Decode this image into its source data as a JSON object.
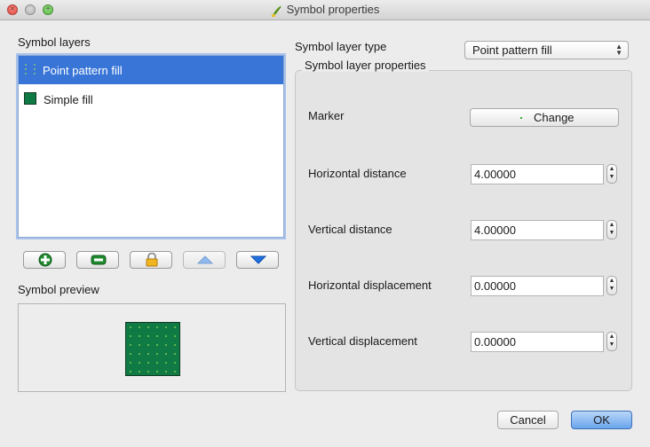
{
  "window": {
    "title": "Symbol properties"
  },
  "left": {
    "layers_heading": "Symbol layers",
    "layers": [
      {
        "label": "Point pattern fill",
        "selected": true,
        "icon": "point-pattern-swatch-icon"
      },
      {
        "label": "Simple fill",
        "selected": false,
        "icon": "simple-fill-swatch-icon",
        "color": "#0f7a43"
      }
    ],
    "toolbar": [
      {
        "name": "add-layer-button",
        "icon": "plus-icon"
      },
      {
        "name": "remove-layer-button",
        "icon": "minus-icon"
      },
      {
        "name": "lock-layer-button",
        "icon": "lock-icon"
      },
      {
        "name": "move-up-button",
        "icon": "arrow-up-icon"
      },
      {
        "name": "move-down-button",
        "icon": "arrow-down-icon"
      }
    ],
    "preview_heading": "Symbol preview"
  },
  "right": {
    "type_label": "Symbol layer type",
    "type_value": "Point pattern fill",
    "group_title": "Symbol layer properties",
    "marker_label": "Marker",
    "change_label": "Change",
    "fields": [
      {
        "label": "Horizontal distance",
        "value": "4.00000"
      },
      {
        "label": "Vertical distance",
        "value": "4.00000"
      },
      {
        "label": "Horizontal displacement",
        "value": "0.00000"
      },
      {
        "label": "Vertical displacement",
        "value": "0.00000"
      }
    ]
  },
  "footer": {
    "cancel_label": "Cancel",
    "ok_label": "OK"
  },
  "colors": {
    "selection": "#3875d7",
    "fill_green": "#0f7a43",
    "pattern_dot": "#9be05a",
    "ok_blue": "#6aa4ec"
  }
}
